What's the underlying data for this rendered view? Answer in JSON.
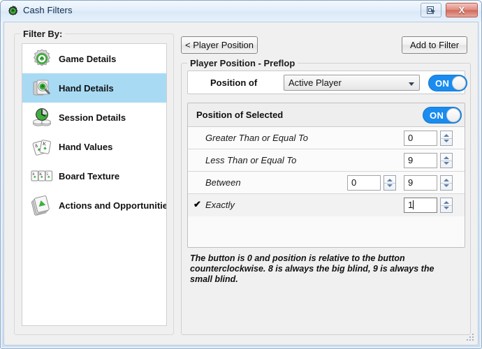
{
  "window": {
    "title": "Cash Filters",
    "app_icon": "gear-green-icon",
    "restore_button_label": "",
    "close_button_label": "X"
  },
  "sidebar": {
    "group_label": "Filter By:",
    "items": [
      {
        "label": "Game Details",
        "icon": "gear-spade-icon",
        "selected": false
      },
      {
        "label": "Hand Details",
        "icon": "cards-magnifier-icon",
        "selected": true
      },
      {
        "label": "Session Details",
        "icon": "chips-clock-icon",
        "selected": false
      },
      {
        "label": "Hand Values",
        "icon": "two-cards-icon",
        "selected": false
      },
      {
        "label": "Board Texture",
        "icon": "three-cards-icon",
        "selected": false
      },
      {
        "label": "Actions and Opportunities",
        "icon": "card-stack-icon",
        "selected": false
      }
    ]
  },
  "main": {
    "back_button": "< Player Position",
    "add_to_filter_button": "Add to Filter",
    "group_label": "Player Position - Preflop",
    "position_of": {
      "label": "Position of",
      "dropdown_value": "Active Player",
      "toggle_label": "ON",
      "toggle_on": true
    },
    "selected_panel": {
      "header_label": "Position of Selected",
      "toggle_label": "ON",
      "toggle_on": true,
      "rows": [
        {
          "label": "Greater Than or Equal To",
          "checked": false,
          "value_a": null,
          "value_b": "0"
        },
        {
          "label": "Less Than or Equal To",
          "checked": false,
          "value_a": null,
          "value_b": "9"
        },
        {
          "label": "Between",
          "checked": false,
          "value_a": "0",
          "value_b": "9"
        },
        {
          "label": "Exactly",
          "checked": true,
          "value_a": null,
          "value_b": "1"
        }
      ],
      "check_glyph": "✔"
    },
    "help_text": "The button is 0 and position is relative to the button counterclockwise.  8 is always the big blind, 9 is always the small blind."
  },
  "colors": {
    "accent_blue": "#1a8cf0",
    "selection_blue": "#a8daf4",
    "titlebar_blue": "#dce9f7",
    "close_red": "#cf6a5c",
    "icon_green": "#3fae3f"
  }
}
